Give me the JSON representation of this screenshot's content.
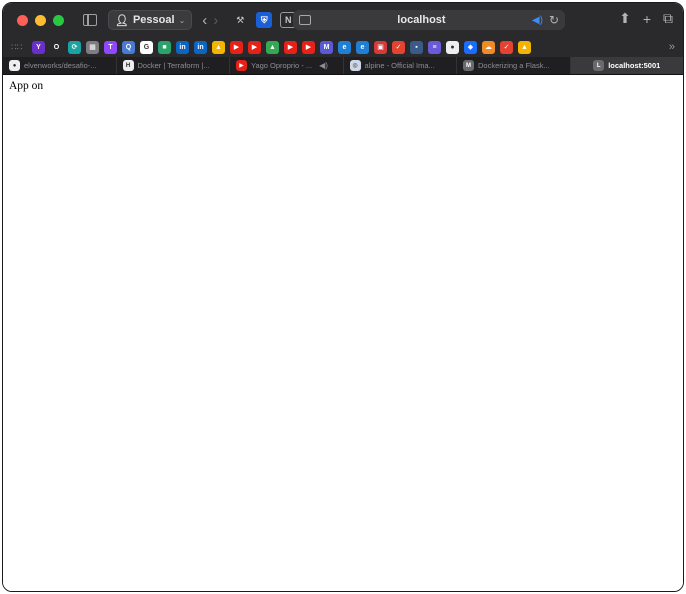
{
  "toolbar": {
    "profile_label": "Pessoal",
    "address_url": "localhost"
  },
  "icons": {
    "traffic_colors": [
      "#ff5f57",
      "#febc2e",
      "#28c840"
    ],
    "favorites": [
      {
        "name": "yahoo-icon",
        "color": "#6b2fc9",
        "glyph": "Y"
      },
      {
        "name": "circle-o-icon",
        "color": "#2a2a2c",
        "glyph": "O"
      },
      {
        "name": "hub-icon",
        "color": "#1aa3a3",
        "glyph": "⟳"
      },
      {
        "name": "calendar-icon",
        "color": "#7d7d82",
        "glyph": "▦"
      },
      {
        "name": "twitch-icon",
        "color": "#9146ff",
        "glyph": "T"
      },
      {
        "name": "search-q-icon",
        "color": "#4a7bd4",
        "glyph": "Q"
      },
      {
        "name": "google-icon",
        "color": "#ffffff",
        "glyph": "G"
      },
      {
        "name": "green-square-icon",
        "color": "#29a36a",
        "glyph": "■"
      },
      {
        "name": "linkedin-icon",
        "color": "#0a66c2",
        "glyph": "in"
      },
      {
        "name": "linkedin-icon-2",
        "color": "#0a66c2",
        "glyph": "in"
      },
      {
        "name": "drive-icon",
        "color": "#f4b400",
        "glyph": "▲"
      },
      {
        "name": "youtube-icon",
        "color": "#e62117",
        "glyph": "▶"
      },
      {
        "name": "youtube-icon-2",
        "color": "#e62117",
        "glyph": "▶"
      },
      {
        "name": "drive-icon-2",
        "color": "#34a853",
        "glyph": "▲"
      },
      {
        "name": "youtube-icon-3",
        "color": "#e62117",
        "glyph": "▶"
      },
      {
        "name": "youtube-icon-4",
        "color": "#e62117",
        "glyph": "▶"
      },
      {
        "name": "m-icon",
        "color": "#5a5ad8",
        "glyph": "M"
      },
      {
        "name": "edge-icon",
        "color": "#1f7fd4",
        "glyph": "e"
      },
      {
        "name": "edge-icon-2",
        "color": "#1f7fd4",
        "glyph": "e"
      },
      {
        "name": "red-square-icon",
        "color": "#d43a3a",
        "glyph": "▣"
      },
      {
        "name": "todoist-icon",
        "color": "#e44332",
        "glyph": "✓"
      },
      {
        "name": "grid-icon",
        "color": "#3a5a8a",
        "glyph": "▪"
      },
      {
        "name": "list-icon",
        "color": "#6a5ad8",
        "glyph": "≡"
      },
      {
        "name": "github-icon",
        "color": "#eeeeee",
        "glyph": "●"
      },
      {
        "name": "dropbox-icon",
        "color": "#1a6cff",
        "glyph": "◆"
      },
      {
        "name": "cloud-icon",
        "color": "#f08a24",
        "glyph": "☁"
      },
      {
        "name": "todoist-icon-2",
        "color": "#e44332",
        "glyph": "✓"
      },
      {
        "name": "drive-icon-3",
        "color": "#f4b400",
        "glyph": "▲"
      }
    ]
  },
  "tabs": [
    {
      "label": "elvenworks/desafio-...",
      "icon": "github-icon",
      "icon_color": "#eeeeee",
      "glyph": "●",
      "active": false,
      "audio": false
    },
    {
      "label": "Docker | Terraform |...",
      "icon": "terraform-icon",
      "icon_color": "#eeeeee",
      "glyph": "H",
      "active": false,
      "audio": false
    },
    {
      "label": "Yago Oproprio - ...",
      "icon": "youtube-icon",
      "icon_color": "#e62117",
      "glyph": "▶",
      "active": false,
      "audio": true
    },
    {
      "label": "alpine - Official Ima...",
      "icon": "docker-icon",
      "icon_color": "#cfd8e6",
      "glyph": "◎",
      "active": false,
      "audio": false
    },
    {
      "label": "Dockerizing a Flask...",
      "icon": "medium-icon",
      "icon_color": "#6a6a6e",
      "glyph": "M",
      "active": false,
      "audio": false
    },
    {
      "label": "localhost:5001",
      "icon": "letter-l-icon",
      "icon_color": "#6a6a6e",
      "glyph": "L",
      "active": true,
      "audio": false
    }
  ],
  "content": {
    "text": "App on"
  }
}
